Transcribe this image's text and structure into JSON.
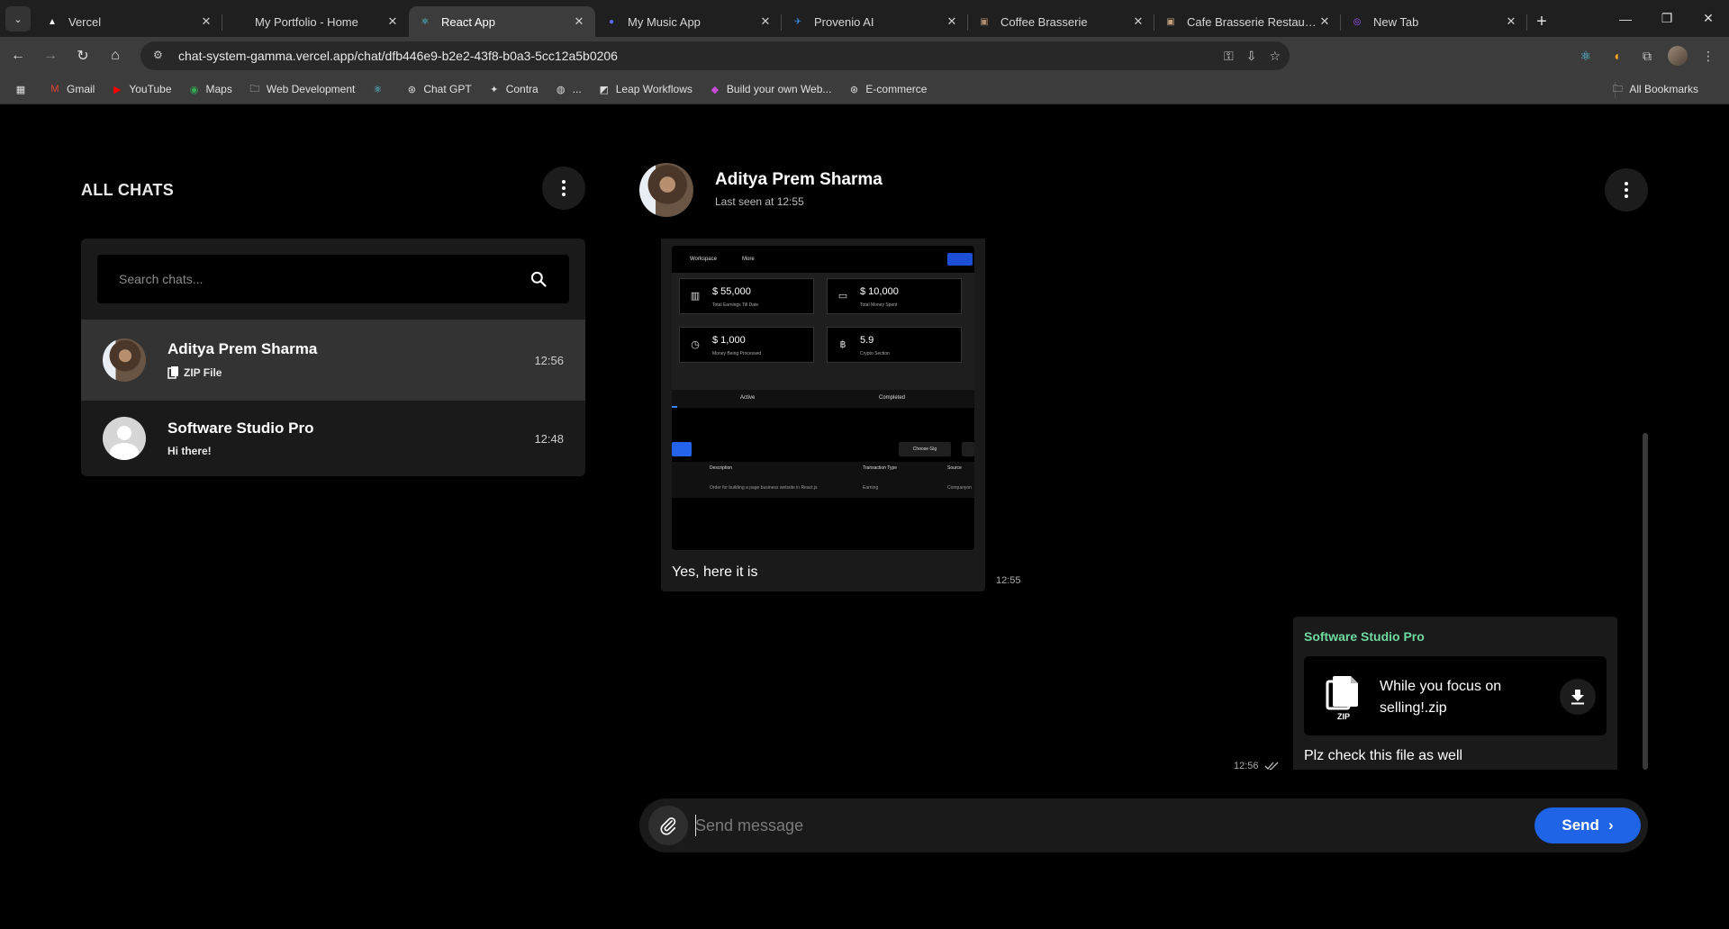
{
  "browser": {
    "tabs": [
      {
        "title": "Vercel",
        "icon": "vercel-icon",
        "color": "#ffffff"
      },
      {
        "title": "My Portfolio - Home",
        "icon": "portfolio-icon",
        "color": "#222222"
      },
      {
        "title": "React App",
        "icon": "react-icon",
        "color": "#61dafb"
      },
      {
        "title": "My Music App",
        "icon": "music-icon",
        "color": "#5b6cff"
      },
      {
        "title": "Provenio AI",
        "icon": "provenio-icon",
        "color": "#3a8dde"
      },
      {
        "title": "Coffee Brasserie",
        "icon": "coffee-icon",
        "color": "#b08d6e"
      },
      {
        "title": "Cafe Brasserie Restaurant",
        "icon": "cafe-icon",
        "color": "#c4a27e"
      },
      {
        "title": "New Tab",
        "icon": "newtab-icon",
        "color": "#a259ff"
      }
    ],
    "active_tab": 2,
    "url": "chat-system-gamma.vercel.app/chat/dfb446e9-b2e2-43f8-b0a3-5cc12a5b0206",
    "bookmarks": [
      {
        "label": "Gmail",
        "icon": "gmail-icon"
      },
      {
        "label": "YouTube",
        "icon": "youtube-icon"
      },
      {
        "label": "Maps",
        "icon": "maps-icon"
      },
      {
        "label": "Web Development",
        "icon": "folder-icon"
      },
      {
        "label": "",
        "icon": "react-icon"
      },
      {
        "label": "Chat GPT",
        "icon": "chatgpt-icon"
      },
      {
        "label": "Contra",
        "icon": "contra-icon"
      },
      {
        "label": "...",
        "icon": "globe-icon"
      },
      {
        "label": "Leap Workflows",
        "icon": "leap-icon"
      },
      {
        "label": "Build your own Web...",
        "icon": "build-icon"
      },
      {
        "label": "E-commerce",
        "icon": "ecommerce-icon"
      }
    ],
    "all_bookmarks": "All Bookmarks"
  },
  "sidebar": {
    "title": "ALL CHATS",
    "search_placeholder": "Search chats...",
    "chats": [
      {
        "name": "Aditya Prem Sharma",
        "preview": "ZIP File",
        "time": "12:56",
        "active": true
      },
      {
        "name": "Software Studio Pro",
        "preview": "Hi there!",
        "time": "12:48",
        "active": false
      }
    ]
  },
  "conversation": {
    "name": "Aditya Prem Sharma",
    "status": "Last seen at 12:55",
    "incoming": {
      "text": "Yes, here it is",
      "time": "12:55",
      "preview": {
        "nav": [
          "Workspace",
          "More"
        ],
        "cards": [
          {
            "value": "$ 55,000",
            "label": "Total Earnings Till Date",
            "icon": "chart-icon"
          },
          {
            "value": "$ 10,000",
            "label": "Total Money Spent",
            "icon": "wallet-icon"
          },
          {
            "value": "$ 1,000",
            "label": "Money Being Processed",
            "icon": "clock-icon"
          },
          {
            "value": "5.9",
            "label": "Crypto Section",
            "icon": "bitcoin-icon"
          }
        ],
        "tabs": [
          "Active",
          "Completed"
        ],
        "choose": "Choose Gig",
        "table_headers": [
          "Description",
          "Transaction Type",
          "Source"
        ],
        "table_row": [
          "Order for building a page business website in React.js",
          "Earning",
          "Companyon"
        ]
      }
    },
    "outgoing": {
      "sender": "Software Studio Pro",
      "file_name": "While you focus on selling!.zip",
      "file_type": "ZIP",
      "text": "Plz check this file as well",
      "time": "12:56"
    },
    "composer": {
      "placeholder": "Send message",
      "send_label": "Send"
    }
  }
}
